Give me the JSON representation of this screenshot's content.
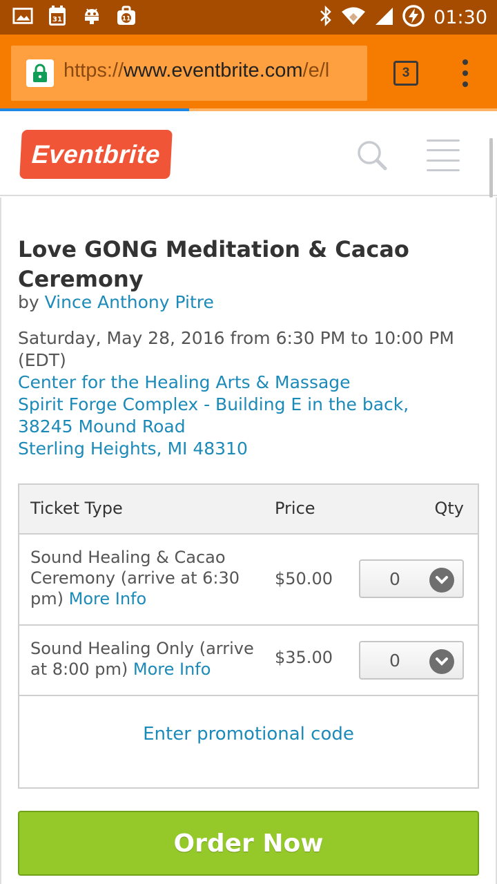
{
  "status_bar": {
    "time": "01:30",
    "icons": [
      "gallery-icon",
      "calendar-icon",
      "android-icon",
      "briefcase-icon",
      "bluetooth-icon",
      "wifi-icon",
      "signal-icon",
      "battery-charging-icon"
    ],
    "calendar_badge": "31",
    "briefcase_badge": "11",
    "bg_color": "#a64c00"
  },
  "browser": {
    "url_scheme": "https://",
    "url_host": "www.eventbrite.com",
    "url_path": "/e/l",
    "tab_count": "3",
    "toolbar_color": "#f57c00"
  },
  "site_header": {
    "logo_text": "Eventbrite",
    "logo_color": "#f05537"
  },
  "event": {
    "title": "Love GONG Meditation & Cacao Ceremony",
    "by_label": "by",
    "organizer": "Vince Anthony Pitre",
    "date": "Saturday, May 28, 2016 from 6:30 PM to 10:00 PM (EDT)",
    "venue_name": "Center for the Healing Arts & Massage",
    "address_line1": "Spirit Forge Complex - Building E in the back,",
    "address_line2": "38245 Mound Road",
    "address_line3": "Sterling Heights, MI 48310"
  },
  "tickets": {
    "headers": {
      "type": "Ticket Type",
      "price": "Price",
      "qty": "Qty"
    },
    "rows": [
      {
        "name": "Sound Healing & Cacao Ceremony (arrive at 6:30 pm)",
        "more_info": "More Info",
        "price": "$50.00",
        "qty": "0"
      },
      {
        "name": "Sound Healing Only (arrive at 8:00 pm)",
        "more_info": "More Info",
        "price": "$35.00",
        "qty": "0"
      }
    ],
    "promo_link": "Enter promotional code"
  },
  "order_button": {
    "label": "Order Now",
    "color": "#95c92a"
  },
  "link_color": "#1c8ab8"
}
